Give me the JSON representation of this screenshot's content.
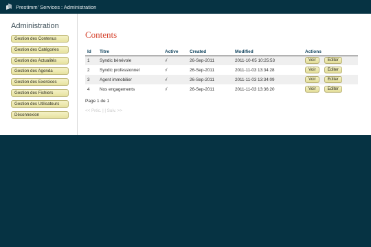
{
  "topbar": {
    "title": "Prestimm' Services : Administration"
  },
  "sidebar": {
    "heading": "Administration",
    "items": [
      {
        "label": "Gestion des Contenus"
      },
      {
        "label": "Gestion des Catégories"
      },
      {
        "label": "Gestion des Actualités"
      },
      {
        "label": "Gestion des Agenda"
      },
      {
        "label": "Gestion des Exercices"
      },
      {
        "label": "Gestion des Fichiers"
      },
      {
        "label": "Gestion des Utilisateurs"
      },
      {
        "label": "Déconnexion"
      }
    ]
  },
  "main": {
    "title": "Contents",
    "table": {
      "headers": {
        "id": "Id",
        "titre": "Titre",
        "active": "Active",
        "created": "Created",
        "modified": "Modified",
        "actions": "Actions"
      },
      "rows": [
        {
          "id": "1",
          "titre": "Syndic bénévole",
          "active": "√",
          "created": "26-Sep-2011",
          "modified": "2011-10-05 10:25:53",
          "voir": "Voir",
          "editer": "Editer"
        },
        {
          "id": "2",
          "titre": "Syndic professionnel",
          "active": "√",
          "created": "26-Sep-2011",
          "modified": "2011-11-03 13:34:28",
          "voir": "Voir",
          "editer": "Editer"
        },
        {
          "id": "3",
          "titre": "Agent immobilier",
          "active": "√",
          "created": "26-Sep-2011",
          "modified": "2011-11-03 13:34:09",
          "voir": "Voir",
          "editer": "Editer"
        },
        {
          "id": "4",
          "titre": "Nos engagements",
          "active": "√",
          "created": "26-Sep-2011",
          "modified": "2011-11-03 13:36:20",
          "voir": "Voir",
          "editer": "Editer"
        }
      ]
    },
    "pager": {
      "text": "Page 1 de 1",
      "links": "<< Préc. | | Suiv. >>"
    }
  }
}
